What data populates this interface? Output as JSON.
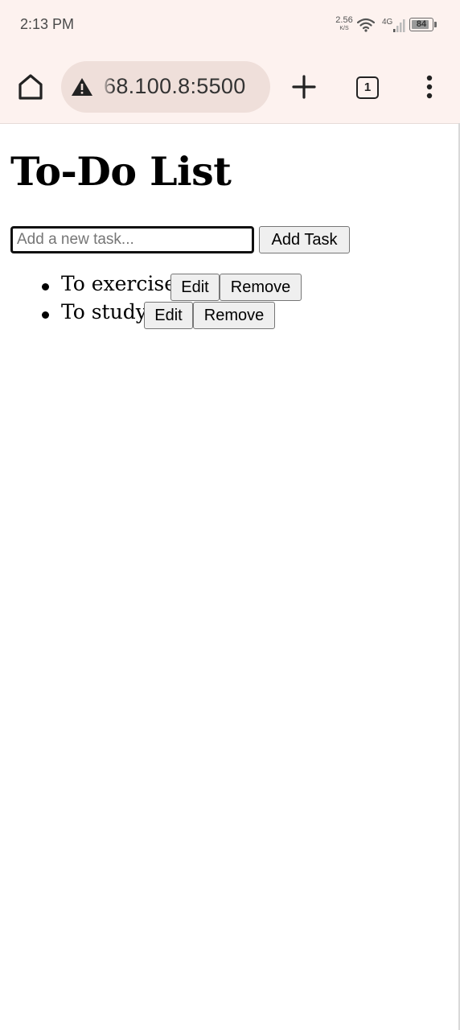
{
  "status_bar": {
    "time": "2:13 PM",
    "net_speed_value": "2.56",
    "net_speed_unit": "K/S",
    "network_type": "4G",
    "battery_percent": "84",
    "icons": [
      "wifi-icon",
      "signal-icon",
      "battery-icon"
    ]
  },
  "browser": {
    "url": "68.100.8:5500",
    "tab_count": "1",
    "icons": [
      "home-icon",
      "warning-icon",
      "plus-icon",
      "tabs-icon",
      "more-vert-icon"
    ]
  },
  "page": {
    "title": "To-Do List",
    "input": {
      "placeholder": "Add a new task...",
      "value": ""
    },
    "add_button_label": "Add Task",
    "tasks": [
      {
        "text": "To exercise",
        "edit_label": "Edit",
        "remove_label": "Remove"
      },
      {
        "text": "To study",
        "edit_label": "Edit",
        "remove_label": "Remove"
      }
    ]
  },
  "colors": {
    "browser_chrome_bg": "#fdf2ef",
    "url_pill_bg": "#efdfda",
    "page_bg": "#ffffff",
    "button_bg": "#efefef"
  }
}
